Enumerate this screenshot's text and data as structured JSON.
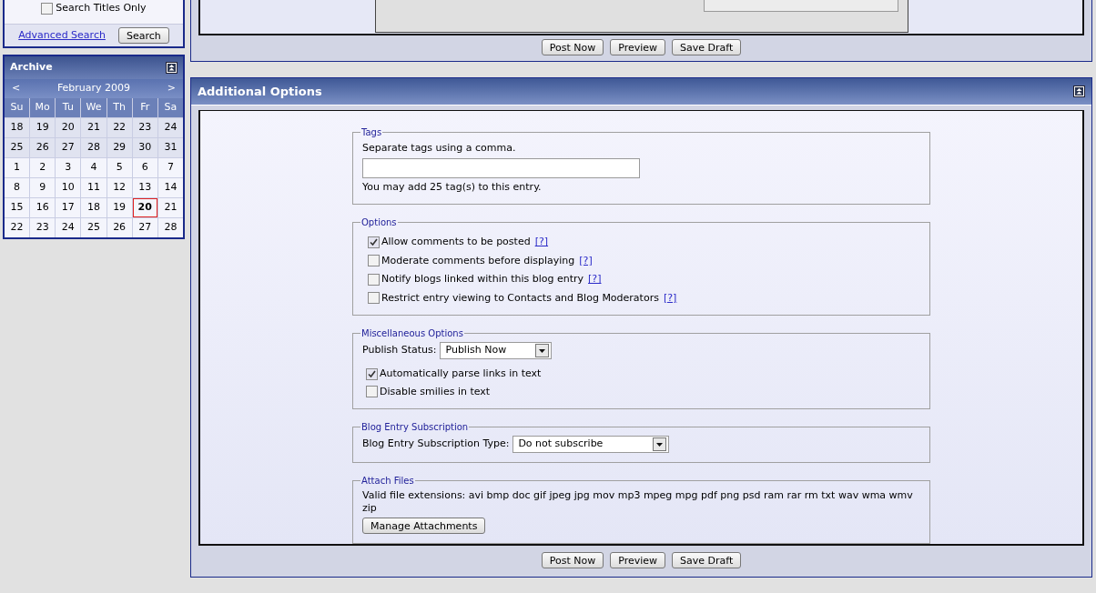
{
  "search": {
    "titles_only": {
      "label": "Search Titles Only",
      "checked": false
    },
    "advanced_link": "Advanced Search",
    "button": "Search"
  },
  "archive": {
    "title": "Archive",
    "prev": "<",
    "month": "February 2009",
    "next": ">",
    "weekdays": [
      "Su",
      "Mo",
      "Tu",
      "We",
      "Th",
      "Fr",
      "Sa"
    ],
    "weeks": [
      [
        {
          "day": "18",
          "other_month": true,
          "selected": false
        },
        {
          "day": "19",
          "other_month": true,
          "selected": false
        },
        {
          "day": "20",
          "other_month": true,
          "selected": false
        },
        {
          "day": "21",
          "other_month": true,
          "selected": false
        },
        {
          "day": "22",
          "other_month": true,
          "selected": false
        },
        {
          "day": "23",
          "other_month": true,
          "selected": false
        },
        {
          "day": "24",
          "other_month": true,
          "selected": false
        }
      ],
      [
        {
          "day": "25",
          "other_month": true,
          "selected": false
        },
        {
          "day": "26",
          "other_month": true,
          "selected": false
        },
        {
          "day": "27",
          "other_month": true,
          "selected": false
        },
        {
          "day": "28",
          "other_month": true,
          "selected": false
        },
        {
          "day": "29",
          "other_month": true,
          "selected": false
        },
        {
          "day": "30",
          "other_month": true,
          "selected": false
        },
        {
          "day": "31",
          "other_month": true,
          "selected": false
        }
      ],
      [
        {
          "day": "1",
          "other_month": false,
          "selected": false
        },
        {
          "day": "2",
          "other_month": false,
          "selected": false
        },
        {
          "day": "3",
          "other_month": false,
          "selected": false
        },
        {
          "day": "4",
          "other_month": false,
          "selected": false
        },
        {
          "day": "5",
          "other_month": false,
          "selected": false
        },
        {
          "day": "6",
          "other_month": false,
          "selected": false
        },
        {
          "day": "7",
          "other_month": false,
          "selected": false
        }
      ],
      [
        {
          "day": "8",
          "other_month": false,
          "selected": false
        },
        {
          "day": "9",
          "other_month": false,
          "selected": false
        },
        {
          "day": "10",
          "other_month": false,
          "selected": false
        },
        {
          "day": "11",
          "other_month": false,
          "selected": false
        },
        {
          "day": "12",
          "other_month": false,
          "selected": false
        },
        {
          "day": "13",
          "other_month": false,
          "selected": false
        },
        {
          "day": "14",
          "other_month": false,
          "selected": false
        }
      ],
      [
        {
          "day": "15",
          "other_month": false,
          "selected": false
        },
        {
          "day": "16",
          "other_month": false,
          "selected": false
        },
        {
          "day": "17",
          "other_month": false,
          "selected": false
        },
        {
          "day": "18",
          "other_month": false,
          "selected": false
        },
        {
          "day": "19",
          "other_month": false,
          "selected": false
        },
        {
          "day": "20",
          "other_month": false,
          "selected": true
        },
        {
          "day": "21",
          "other_month": false,
          "selected": false
        }
      ],
      [
        {
          "day": "22",
          "other_month": false,
          "selected": false
        },
        {
          "day": "23",
          "other_month": false,
          "selected": false
        },
        {
          "day": "24",
          "other_month": false,
          "selected": false
        },
        {
          "day": "25",
          "other_month": false,
          "selected": false
        },
        {
          "day": "26",
          "other_month": false,
          "selected": false
        },
        {
          "day": "27",
          "other_month": false,
          "selected": false
        },
        {
          "day": "28",
          "other_month": false,
          "selected": false
        }
      ]
    ]
  },
  "top_buttons": [
    "Post Now",
    "Preview",
    "Save Draft"
  ],
  "additional_options": {
    "title": "Additional Options",
    "tags": {
      "legend": "Tags",
      "hint": "Separate tags using a comma.",
      "note": "You may add 25 tag(s) to this entry."
    },
    "options": {
      "legend": "Options",
      "items": [
        {
          "label": "Allow comments to be posted",
          "help": "[?]",
          "checked": true
        },
        {
          "label": "Moderate comments before displaying",
          "help": "[?]",
          "checked": false
        },
        {
          "label": "Notify blogs linked within this blog entry",
          "help": "[?]",
          "checked": false
        },
        {
          "label": "Restrict entry viewing to Contacts and Blog Moderators",
          "help": "[?]",
          "checked": false
        }
      ]
    },
    "misc": {
      "legend": "Miscellaneous Options",
      "publish_label": "Publish Status:",
      "publish_value": "Publish Now",
      "items": [
        {
          "label": "Automatically parse links in text",
          "checked": true
        },
        {
          "label": "Disable smilies in text",
          "checked": false
        }
      ]
    },
    "subscription": {
      "legend": "Blog Entry Subscription",
      "label": "Blog Entry Subscription Type:",
      "value": "Do not subscribe"
    },
    "attach": {
      "legend": "Attach Files",
      "extensions": "Valid file extensions: avi bmp doc gif jpeg jpg mov mp3 mpeg mpg pdf png psd ram rar rm txt wav wma wmv zip",
      "button": "Manage Attachments"
    },
    "buttons": [
      "Post Now",
      "Preview",
      "Save Draft"
    ]
  }
}
